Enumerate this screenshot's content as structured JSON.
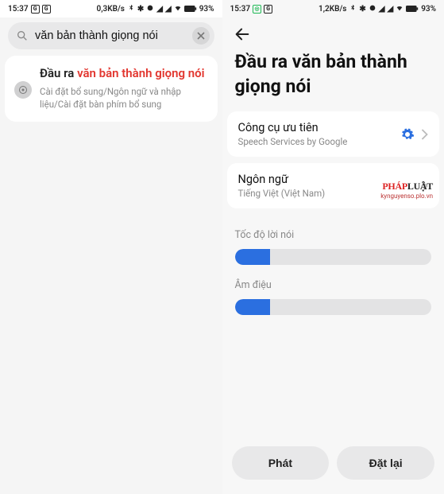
{
  "left": {
    "status": {
      "time": "15:37",
      "net": "0,3KB/s",
      "battery": "93%"
    },
    "search": {
      "value": "văn bản thành giọng nói"
    },
    "result": {
      "title_prefix": "Đầu ra ",
      "title_highlight": "văn bản thành giọng nói",
      "subtitle": "Cài đặt bổ sung/Ngôn ngữ và nhập liệu/Cài đặt bàn phím bổ sung"
    }
  },
  "right": {
    "status": {
      "time": "15:37",
      "net": "1,2KB/s",
      "battery": "93%"
    },
    "title": "Đầu ra văn bản thành giọng nói",
    "items": [
      {
        "title": "Công cụ ưu tiên",
        "sub": "Speech Services by Google"
      },
      {
        "title": "Ngôn ngữ",
        "sub": "Tiếng Việt (Việt Nam)"
      }
    ],
    "sliders": [
      {
        "label": "Tốc độ lời nói",
        "percent": 18
      },
      {
        "label": "Âm điệu",
        "percent": 18
      }
    ],
    "buttons": {
      "play": "Phát",
      "reset": "Đặt lại"
    }
  },
  "watermark": {
    "line1a": "PHÁP",
    "line1b": "LUẬT",
    "line2": "kynguyenso.plo.vn"
  }
}
